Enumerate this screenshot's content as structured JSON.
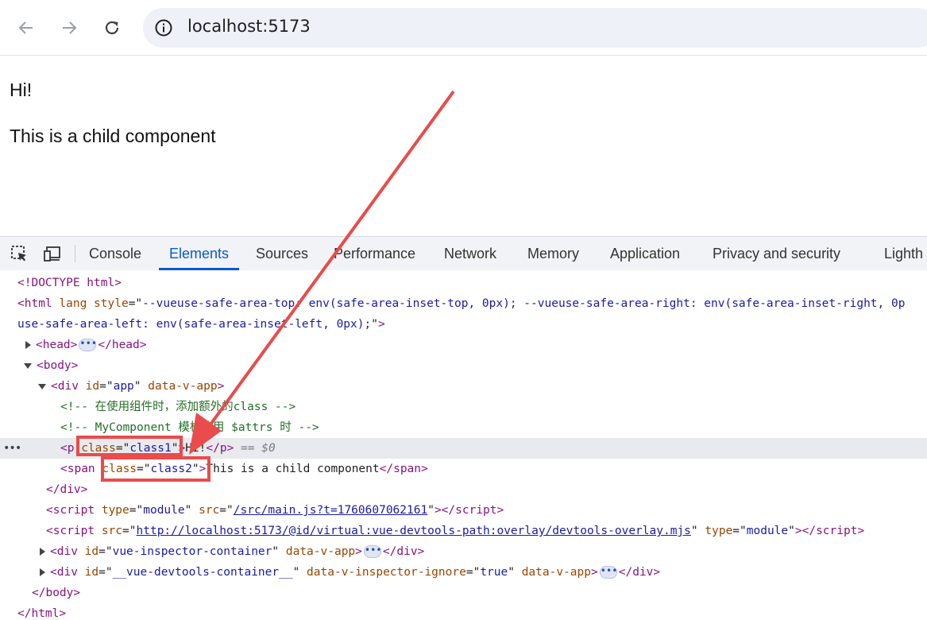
{
  "browser": {
    "back_icon": "back-arrow-icon",
    "forward_icon": "forward-arrow-icon",
    "reload_icon": "reload-icon",
    "site_info_icon": "info-icon",
    "url": "localhost:5173"
  },
  "page": {
    "line1": "Hi!",
    "line2": "This is a child component"
  },
  "devtools": {
    "tabs": [
      "Console",
      "Elements",
      "Sources",
      "Performance",
      "Network",
      "Memory",
      "Application",
      "Privacy and security",
      "Lighth"
    ],
    "active_tab": "Elements",
    "dom": {
      "doctype": "<!DOCTYPE html>",
      "html_style_1": "--vueuse-safe-area-top: env(safe-area-inset-top, 0px); --vueuse-safe-area-right: env(safe-area-inset-right, 0p",
      "html_style_2": "use-safe-area-left: env(safe-area-inset-left, 0px);",
      "comment1": "<!-- 在使用组件时，添加额外的class -->",
      "comment2": "<!-- MyComponent 模板使用 $attrs 时 -->",
      "p_class": "class1",
      "p_text": "Hi!",
      "dollar0": "== $0",
      "span_class": "class2",
      "span_text": "This is a child component",
      "script1_src": "/src/main.js?t=1760607062161",
      "script2_src": "http://localhost:5173/@id/virtual:vue-devtools-path:overlay/devtools-overlay.mjs",
      "script_type": "module",
      "div1_id": "vue-inspector-container",
      "div2_id": "__vue-devtools-container__",
      "inspector_ignore": "true",
      "app_id": "app"
    }
  },
  "colors": {
    "annotation_red": "#ea4b4b",
    "active_tab_blue": "#0b57d0"
  }
}
